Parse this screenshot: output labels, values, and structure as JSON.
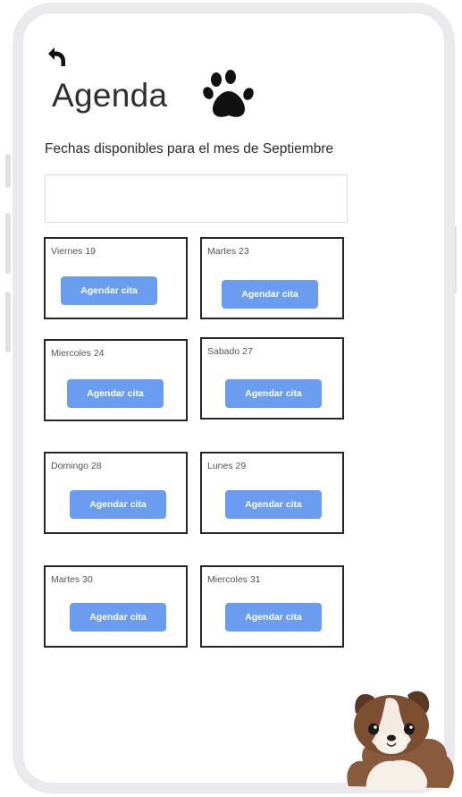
{
  "header": {
    "title": "Agenda",
    "subtitle": "Fechas disponibles para el mes de Septiembre"
  },
  "search": {
    "value": "",
    "placeholder": ""
  },
  "dates": [
    {
      "label": "Viernes 19",
      "button": "Agendar cita"
    },
    {
      "label": "Martes 23",
      "button": "Agendar cita"
    },
    {
      "label": "Miercoles 24",
      "button": "Agendar cita"
    },
    {
      "label": "Sabado 27",
      "button": "Agendar cita"
    },
    {
      "label": "Domingo 28",
      "button": "Agendar cita"
    },
    {
      "label": "Lunes 29",
      "button": "Agendar cita"
    },
    {
      "label": "Martes 30",
      "button": "Agendar cita"
    },
    {
      "label": "Miercoles 31",
      "button": "Agendar cita"
    }
  ],
  "icons": {
    "back": "back-arrow-icon",
    "paw": "paw-icon",
    "mascot": "dog-illustration"
  },
  "colors": {
    "button": "#6a9df0",
    "card_border": "#262626",
    "phone_frame": "#e9e9ee"
  }
}
